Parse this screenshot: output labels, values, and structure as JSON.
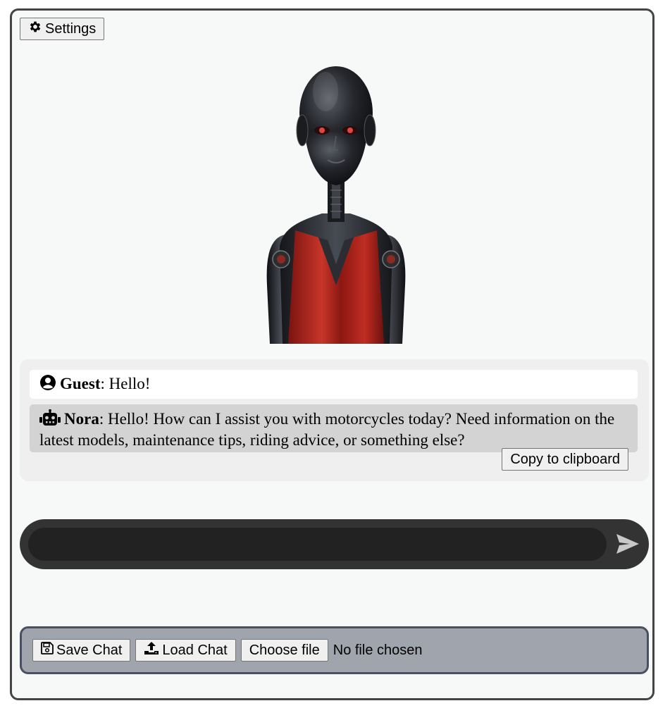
{
  "header": {
    "settings_label": "Settings",
    "settings_icon": "gear-icon"
  },
  "avatar": {
    "description_icon": "robot-avatar-image"
  },
  "chat": {
    "messages": [
      {
        "role": "user",
        "icon": "user-circle-icon",
        "sender": "Guest",
        "text": ": Hello!"
      },
      {
        "role": "bot",
        "icon": "robot-icon",
        "sender": "Nora",
        "text": ": Hello! How can I assist you with motorcycles today? Need information on the latest models, maintenance tips, riding advice, or something else?"
      }
    ],
    "copy_label": "Copy to clipboard"
  },
  "input": {
    "value": "",
    "placeholder": "",
    "send_icon": "send-arrow-icon"
  },
  "file_bar": {
    "save_label": "Save Chat",
    "load_label": "Load Chat",
    "choose_label": "Choose file",
    "file_status": "No file chosen"
  },
  "colors": {
    "frame_bg": "#f7f8f8",
    "chat_panel_bg": "#efefef",
    "bot_msg_bg": "#d3d3d3",
    "input_bar_bg": "#333333",
    "input_field_bg": "#222222",
    "file_bar_bg": "#a0a4ac",
    "dress_red": "#b3221c"
  }
}
